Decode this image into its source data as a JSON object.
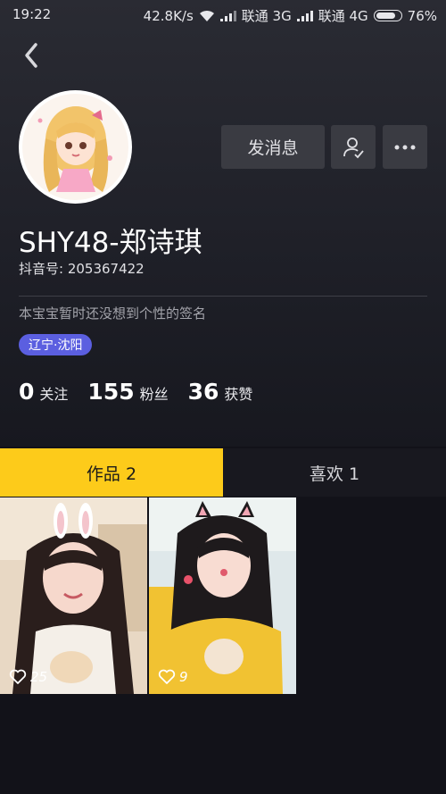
{
  "status_bar": {
    "time": "19:22",
    "speed": "42.8K/s",
    "carrier1": "联通 3G",
    "carrier2": "联通 4G",
    "battery": "76%"
  },
  "profile": {
    "name": "SHY48-郑诗琪",
    "douyin_id": "抖音号: 205367422",
    "signature": "本宝宝暂时还没想到个性的签名",
    "location": "辽宁·沈阳",
    "message_button": "发消息"
  },
  "stats": [
    {
      "num": "0",
      "label": "关注"
    },
    {
      "num": "155",
      "label": "粉丝"
    },
    {
      "num": "36",
      "label": "获赞"
    }
  ],
  "tabs": [
    {
      "label": "作品 2",
      "active": true
    },
    {
      "label": "喜欢 1",
      "active": false
    }
  ],
  "videos": [
    {
      "likes": "25",
      "icon": "heart-outline"
    },
    {
      "likes": "9",
      "icon": "heart-outline"
    }
  ],
  "colors": {
    "accent_tab": "#fdcb1a",
    "location_badge": "#5b5fe0",
    "background": "#121219"
  }
}
